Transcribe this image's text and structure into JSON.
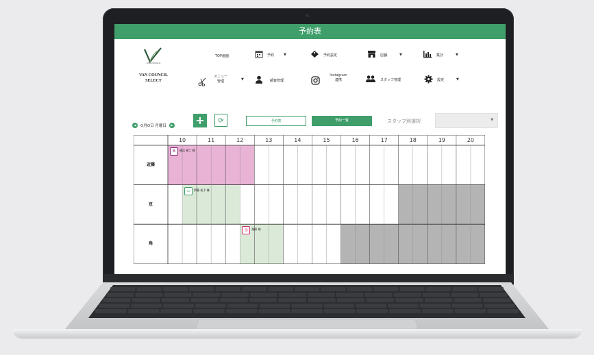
{
  "window": {
    "title": "予約表"
  },
  "logo": {
    "small_text": "VAN COUNCIL",
    "brand_line1": "VAN COUNCIL",
    "brand_line2": "SELECT"
  },
  "nav": {
    "top_screen": "TOP画面",
    "reservation": "予約",
    "reservation_settings": "予約設定",
    "store": "店舗",
    "stats": "集計",
    "menu_mgmt_line1": "メニュー",
    "menu_mgmt_line2": "管理",
    "customer_mgmt": "顧客管理",
    "instagram_line1": "Instagram",
    "instagram_line2": "連携",
    "staff_mgmt": "スタッフ管理",
    "settings": "設定",
    "caret": "▼"
  },
  "controls": {
    "date_text": "O月O日 月曜日",
    "prev_arrow": "◀",
    "next_arrow": "▶",
    "add_label": "+",
    "refresh_label": "⟳",
    "tab_schedule": "予約表",
    "tab_list": "予約一覧",
    "staff_select_label": "スタッフ別選択",
    "staff_select_value": "",
    "select_arrow": "▼"
  },
  "schedule": {
    "hours": [
      "10",
      "11",
      "12",
      "13",
      "14",
      "15",
      "16",
      "17",
      "18",
      "19",
      "20"
    ],
    "staff": [
      "近藤",
      "豆",
      "角"
    ],
    "appointments": [
      {
        "staff": "近藤",
        "icon": "beauty-icon",
        "icon_glyph": "B",
        "name": "篠浜 恵二 様",
        "color": "#e9b3d6",
        "border": "#8a2a7a"
      },
      {
        "staff": "豆",
        "icon": "chat-icon",
        "icon_glyph": "▭",
        "name": "伊藤 花子 様",
        "color": "#dbe9d9",
        "border": "#3f9e6a"
      },
      {
        "staff": "角",
        "icon": "instagram-icon",
        "icon_glyph": "◎",
        "name": "栗原 様",
        "color": "#dbe9d9",
        "border": "#d0306b"
      }
    ],
    "blocked_color": "#b4b4b4"
  }
}
